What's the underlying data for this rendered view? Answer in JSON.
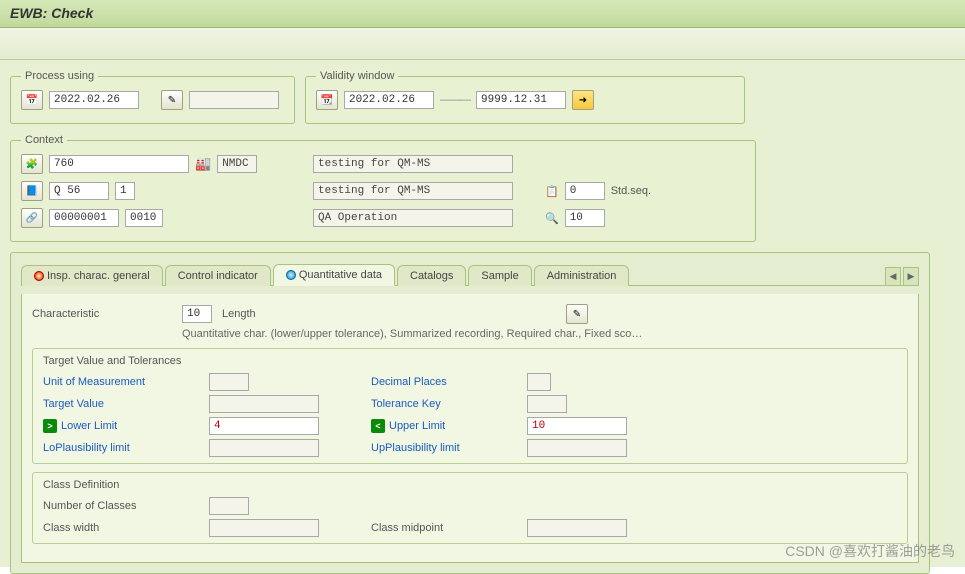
{
  "title": "EWB: Check",
  "process": {
    "legend": "Process using",
    "date": "2022.02.26",
    "extra": ""
  },
  "validity": {
    "legend": "Validity window",
    "from": "2022.02.26",
    "to": "9999.12.31"
  },
  "context": {
    "legend": "Context",
    "plant": "760",
    "plant_name": "NMDC",
    "group": "Q 56",
    "counter": "1",
    "routing": "00000001",
    "op": "0010",
    "desc1": "testing for QM-MS",
    "desc2": "testing for QM-MS",
    "desc3": "QA Operation",
    "std_count": "0",
    "std_label": "Std.seq.",
    "char_no": "10"
  },
  "tabs": {
    "items": [
      {
        "label": "Insp. charac. general"
      },
      {
        "label": "Control indicator"
      },
      {
        "label": "Quantitative data"
      },
      {
        "label": "Catalogs"
      },
      {
        "label": "Sample"
      },
      {
        "label": "Administration"
      }
    ]
  },
  "panel": {
    "char_label": "Characteristic",
    "char_value": "10",
    "char_name": "Length",
    "sub_desc": "Quantitative char. (lower/upper tolerance), Summarized recording, Required char., Fixed sco…",
    "target_group": {
      "title": "Target Value and Tolerances",
      "uom_label": "Unit of Measurement",
      "uom": "",
      "dec_label": "Decimal Places",
      "dec": "",
      "target_label": "Target Value",
      "target": "",
      "tolkey_label": "Tolerance Key",
      "tolkey": "",
      "lower_label": "Lower Limit",
      "lower": "4",
      "upper_label": "Upper Limit",
      "upper": "10",
      "loplaus_label": "LoPlausibility limit",
      "loplaus": "",
      "upplaus_label": "UpPlausibility limit",
      "upplaus": ""
    },
    "class_group": {
      "title": "Class Definition",
      "num_label": "Number of Classes",
      "num": "",
      "width_label": "Class width",
      "width": "",
      "mid_label": "Class midpoint",
      "mid": ""
    }
  },
  "watermark": "CSDN @喜欢打酱油的老鸟"
}
